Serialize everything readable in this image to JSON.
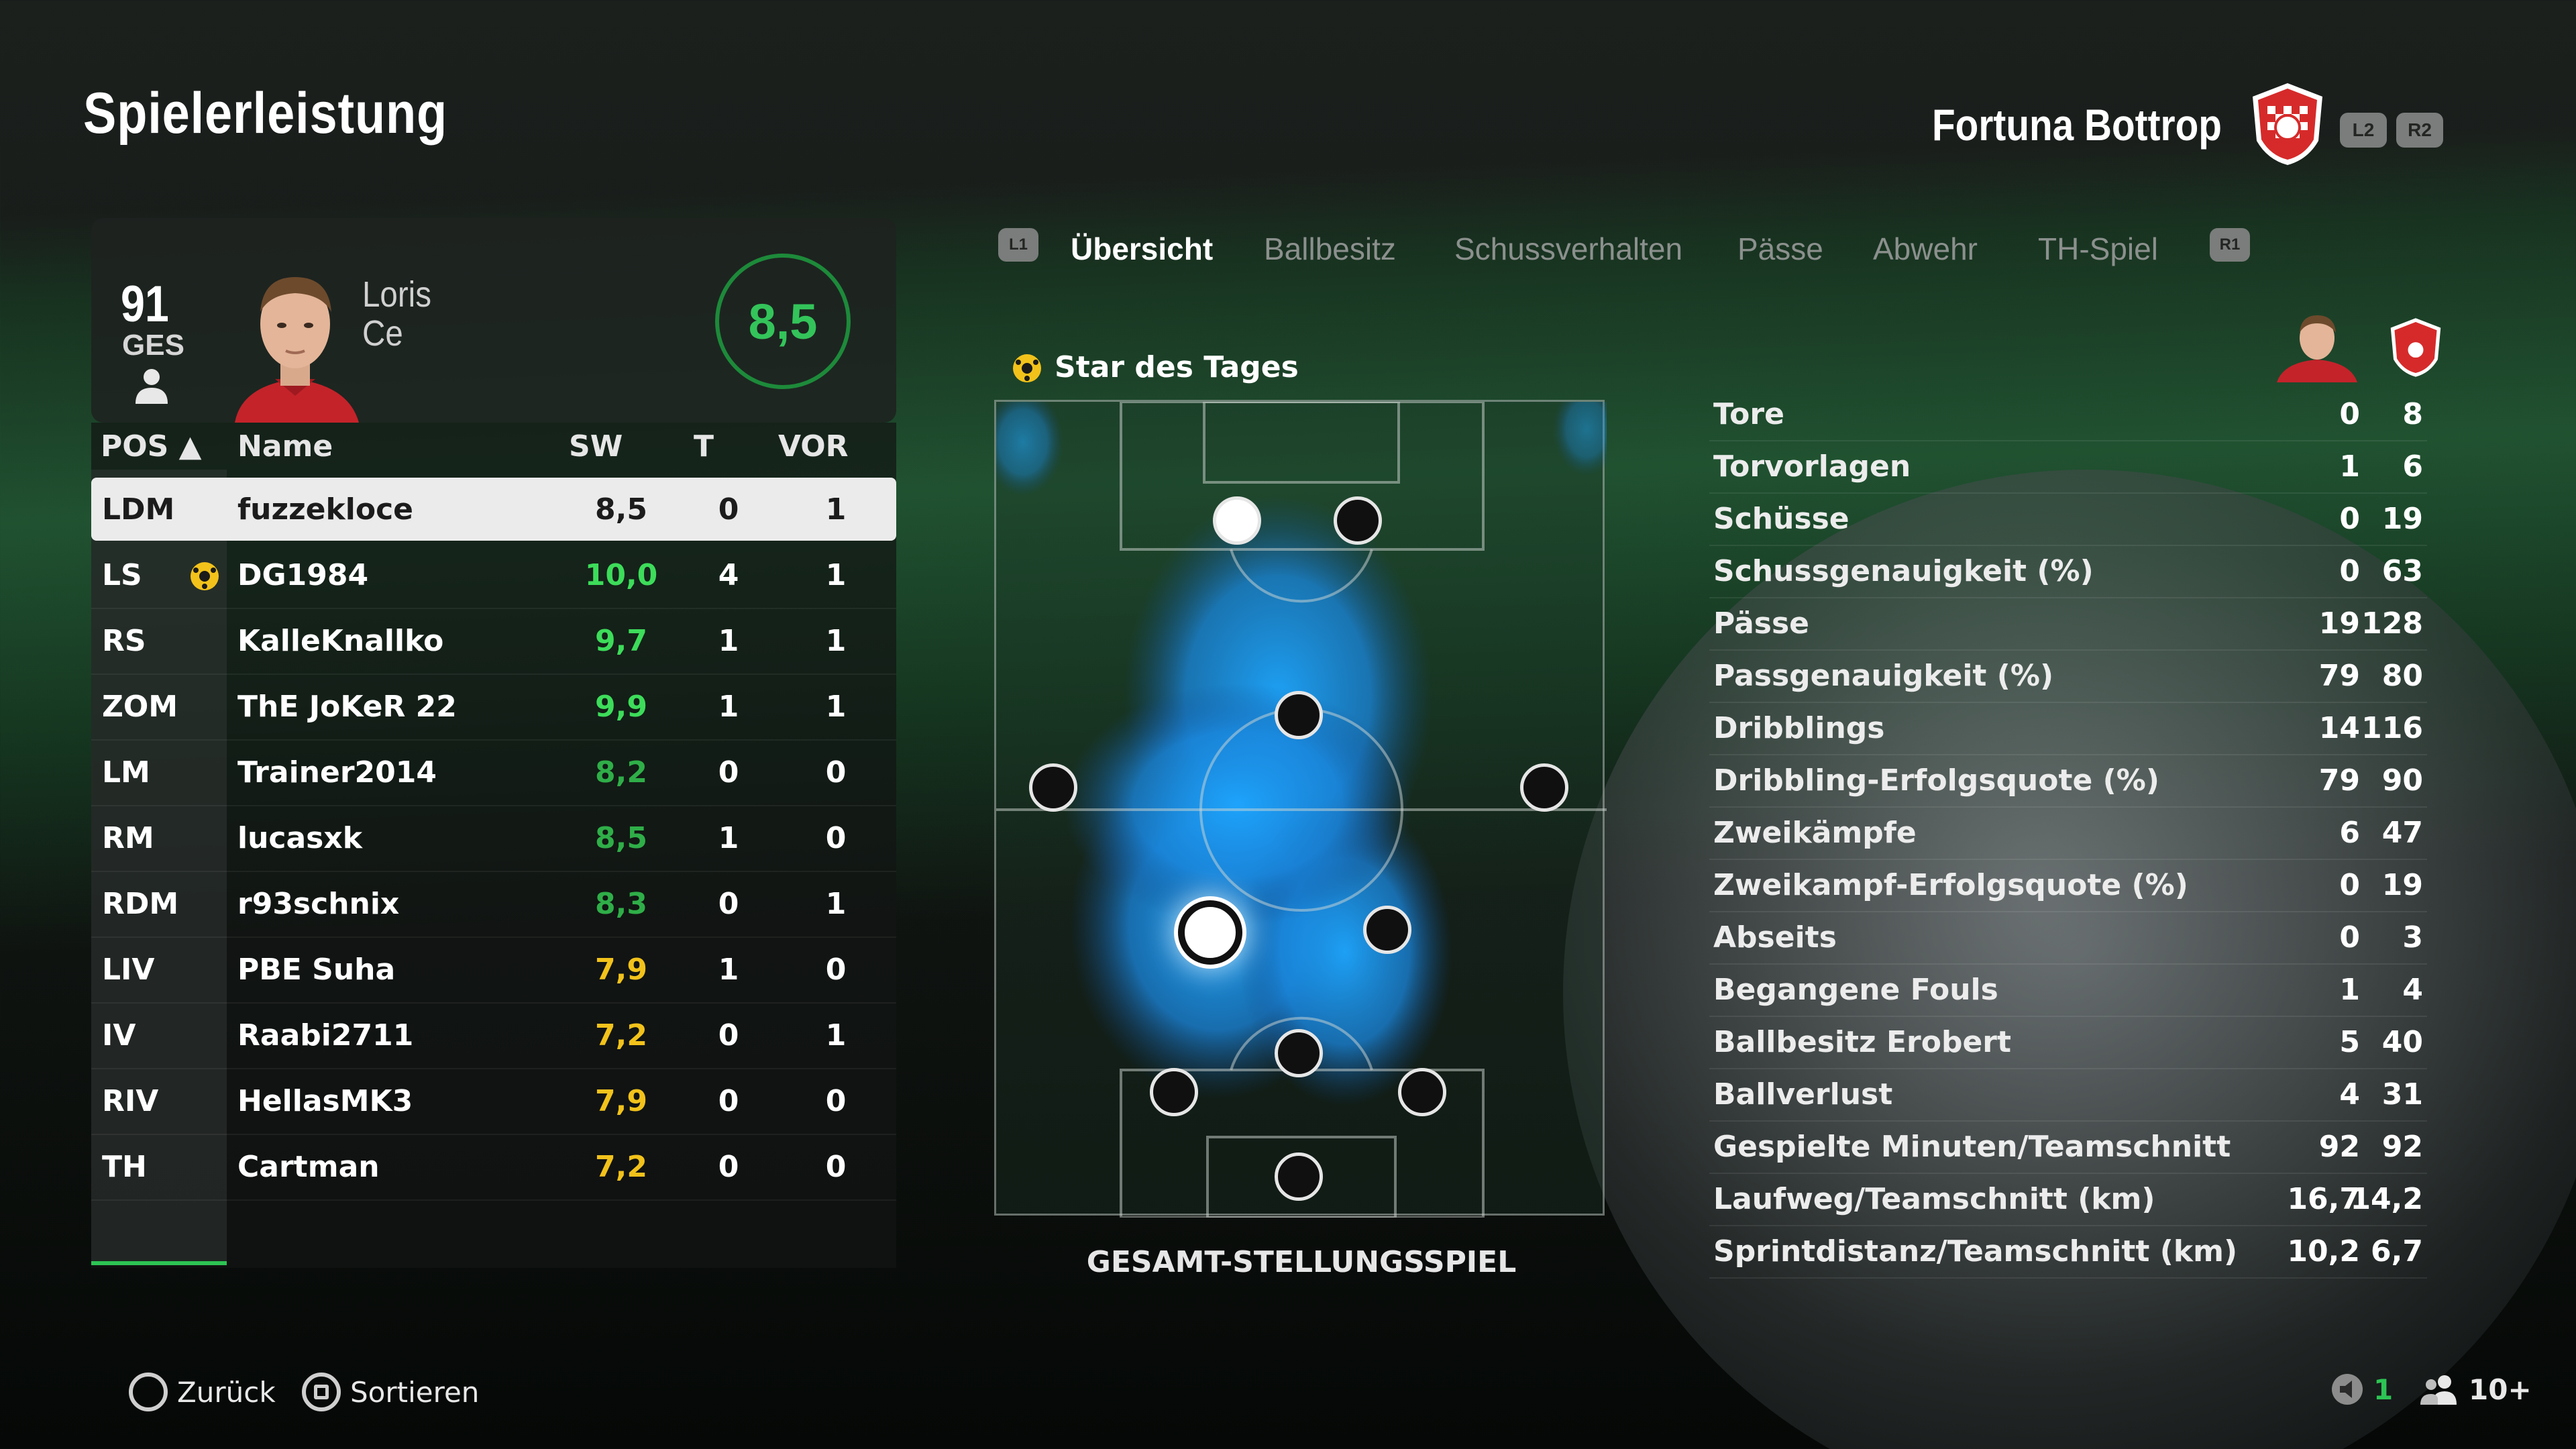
{
  "header": {
    "page_title": "Spielerleistung",
    "team_name": "Fortuna Bottrop",
    "btn_l2": "L2",
    "btn_r2": "R2"
  },
  "player_card": {
    "overall": "91",
    "overall_label": "GES",
    "first_name": "Loris",
    "last_name": "Ce",
    "rating": "8,5"
  },
  "table": {
    "headers": {
      "pos": "POS ▲",
      "name": "Name",
      "sw": "SW",
      "t": "T",
      "vor": "VOR"
    },
    "rows": [
      {
        "pos": "LDM",
        "name": "fuzzekloce",
        "sw": "8,5",
        "t": "0",
        "vor": "1",
        "color": "#1c1c1c",
        "star": false
      },
      {
        "pos": "LS",
        "name": "DG1984",
        "sw": "10,0",
        "t": "4",
        "vor": "1",
        "color": "#3ddc5a",
        "star": true
      },
      {
        "pos": "RS",
        "name": "KalleKnallko",
        "sw": "9,7",
        "t": "1",
        "vor": "1",
        "color": "#3ddc5a",
        "star": false
      },
      {
        "pos": "ZOM",
        "name": "ThE JoKeR 22",
        "sw": "9,9",
        "t": "1",
        "vor": "1",
        "color": "#3ddc5a",
        "star": false
      },
      {
        "pos": "LM",
        "name": "Trainer2014",
        "sw": "8,2",
        "t": "0",
        "vor": "0",
        "color": "#2fae48",
        "star": false
      },
      {
        "pos": "RM",
        "name": "lucasxk",
        "sw": "8,5",
        "t": "1",
        "vor": "0",
        "color": "#2fae48",
        "star": false
      },
      {
        "pos": "RDM",
        "name": "r93schnix",
        "sw": "8,3",
        "t": "0",
        "vor": "1",
        "color": "#2fae48",
        "star": false
      },
      {
        "pos": "LIV",
        "name": "PBE Suha",
        "sw": "7,9",
        "t": "1",
        "vor": "0",
        "color": "#f2c21b",
        "star": false
      },
      {
        "pos": "IV",
        "name": "Raabi2711",
        "sw": "7,2",
        "t": "0",
        "vor": "1",
        "color": "#f2c21b",
        "star": false
      },
      {
        "pos": "RIV",
        "name": "HellasMK3",
        "sw": "7,9",
        "t": "0",
        "vor": "0",
        "color": "#f2c21b",
        "star": false
      },
      {
        "pos": "TH",
        "name": "Cartman",
        "sw": "7,2",
        "t": "0",
        "vor": "0",
        "color": "#f2c21b",
        "star": false
      }
    ]
  },
  "tabs": {
    "l1": "L1",
    "r1": "R1",
    "items": [
      "Übersicht",
      "Ballbesitz",
      "Schussverhalten",
      "Pässe",
      "Abwehr",
      "TH-Spiel"
    ]
  },
  "pitch": {
    "star_label": "Star des Tages",
    "caption": "GESAMT-STELLUNGSSPIEL"
  },
  "stats": [
    {
      "label": "Tore",
      "player": "0",
      "team": "8"
    },
    {
      "label": "Torvorlagen",
      "player": "1",
      "team": "6"
    },
    {
      "label": "Schüsse",
      "player": "0",
      "team": "19"
    },
    {
      "label": "Schussgenauigkeit (%)",
      "player": "0",
      "team": "63"
    },
    {
      "label": "Pässe",
      "player": "19",
      "team": "128"
    },
    {
      "label": "Passgenauigkeit (%)",
      "player": "79",
      "team": "80"
    },
    {
      "label": "Dribblings",
      "player": "14",
      "team": "116"
    },
    {
      "label": "Dribbling-Erfolgsquote (%)",
      "player": "79",
      "team": "90"
    },
    {
      "label": "Zweikämpfe",
      "player": "6",
      "team": "47"
    },
    {
      "label": "Zweikampf-Erfolgsquote (%)",
      "player": "0",
      "team": "19"
    },
    {
      "label": "Abseits",
      "player": "0",
      "team": "3"
    },
    {
      "label": "Begangene Fouls",
      "player": "1",
      "team": "4"
    },
    {
      "label": "Ballbesitz Erobert",
      "player": "5",
      "team": "40"
    },
    {
      "label": "Ballverlust",
      "player": "4",
      "team": "31"
    },
    {
      "label": "Gespielte Minuten/Teamschnitt",
      "player": "92",
      "team": "92"
    },
    {
      "label": "Laufweg/Teamschnitt (km)",
      "player": "16,7",
      "team": "14,2"
    },
    {
      "label": "Sprintdistanz/Teamschnitt (km)",
      "player": "10,2",
      "team": "6,7"
    }
  ],
  "footer": {
    "back_label": "Zurück",
    "sort_label": "Sortieren",
    "mic_count": "1",
    "players_count": "10+"
  },
  "colors": {
    "accent_green": "#2dc454",
    "heatmap_blue": "#1e9bff",
    "crest_red": "#d62a2a"
  }
}
